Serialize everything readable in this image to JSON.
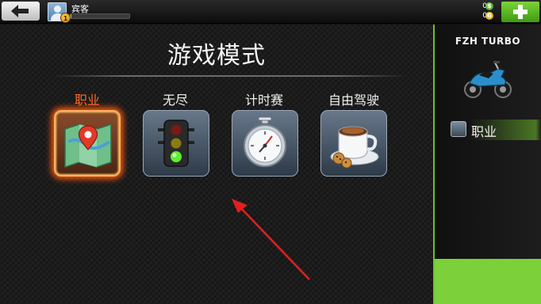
{
  "topbar": {
    "back_icon": "back-arrow-icon",
    "player_name": "宾客",
    "level": "1",
    "xp_progress": 0.02,
    "cash": "0",
    "gold": "0",
    "cash_icon": "dollar-coin-icon",
    "gold_icon": "gold-coin-icon",
    "add_icon": "plus-icon",
    "cash_symbol": "$",
    "gold_symbol": "G"
  },
  "main": {
    "title": "游戏模式",
    "modes": [
      {
        "label": "职业",
        "icon": "map-pin-icon",
        "active": true
      },
      {
        "label": "无尽",
        "icon": "traffic-light-icon",
        "active": false
      },
      {
        "label": "计时赛",
        "icon": "stopwatch-icon",
        "active": false
      },
      {
        "label": "自由驾驶",
        "icon": "coffee-cup-icon",
        "active": false
      }
    ]
  },
  "sidebar": {
    "bike_name": "FZH TURBO",
    "bike_icon": "motorcycle-icon",
    "selected_mode": "职业"
  },
  "colors": {
    "accent_green": "#7cd13a",
    "active_orange": "#ff6a2a",
    "annotation_arrow": "#e02020"
  }
}
